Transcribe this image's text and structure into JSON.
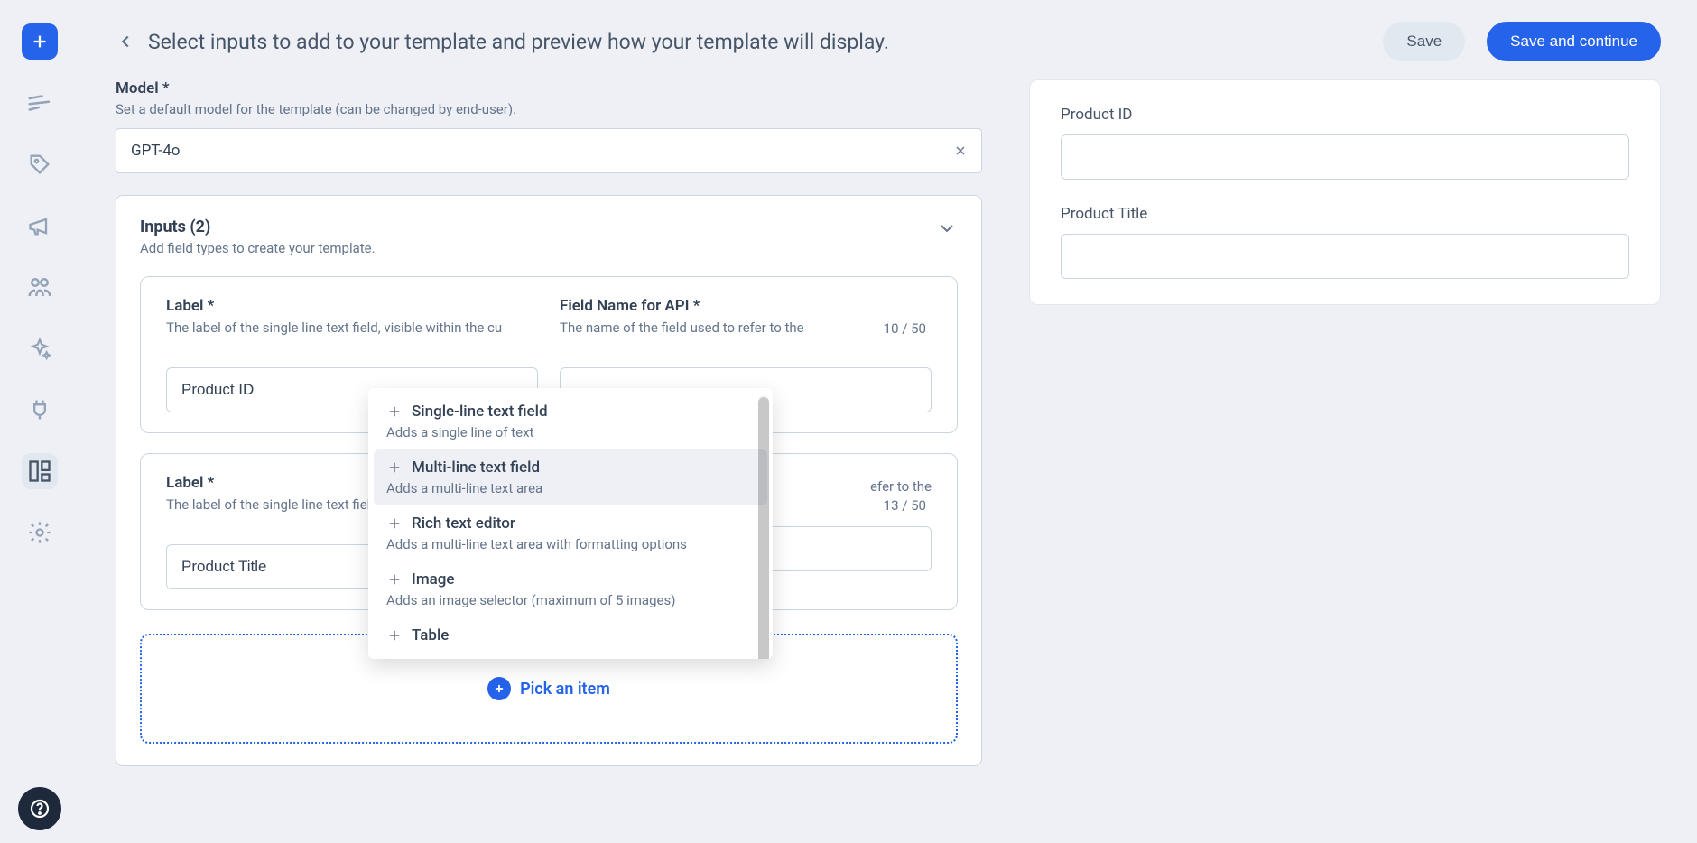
{
  "header": {
    "title": "Select inputs to add to your template and preview how your template will display.",
    "save": "Save",
    "save_continue": "Save and continue"
  },
  "model": {
    "label": "Model *",
    "helper": "Set a default model for the template (can be changed by end-user).",
    "value": "GPT-4o"
  },
  "inputs_section": {
    "title": "Inputs (2)",
    "helper": "Add field types to create your template."
  },
  "fields": [
    {
      "label_title": "Label *",
      "label_helper": "The label of the single line text field, visible within the cu",
      "label_value": "Product ID",
      "api_title": "Field Name for API *",
      "api_helper": "The name of the field used to refer to the",
      "api_value": "",
      "count": "10 / 50"
    },
    {
      "label_title": "Label *",
      "label_helper": "The label of the single line text field, visible within the cu",
      "label_value": "Product Title",
      "api_title": "",
      "api_helper": "efer to the",
      "api_value": "",
      "count": "13 / 50"
    }
  ],
  "dropdown": {
    "items": [
      {
        "title": "Single-line text field",
        "sub": "Adds a single line of text"
      },
      {
        "title": "Multi-line text field",
        "sub": "Adds a multi-line text area"
      },
      {
        "title": "Rich text editor",
        "sub": "Adds a multi-line text area with formatting options"
      },
      {
        "title": "Image",
        "sub": "Adds an image selector (maximum of 5 images)"
      },
      {
        "title": "Table",
        "sub": ""
      }
    ],
    "hover_index": 1
  },
  "pick": {
    "label": "Pick an item"
  },
  "preview": {
    "fields": [
      {
        "label": "Product ID"
      },
      {
        "label": "Product Title"
      }
    ]
  },
  "sidebar": {
    "items": [
      "create",
      "list",
      "tag",
      "announce",
      "community",
      "sparkle",
      "integration",
      "template",
      "settings"
    ]
  }
}
